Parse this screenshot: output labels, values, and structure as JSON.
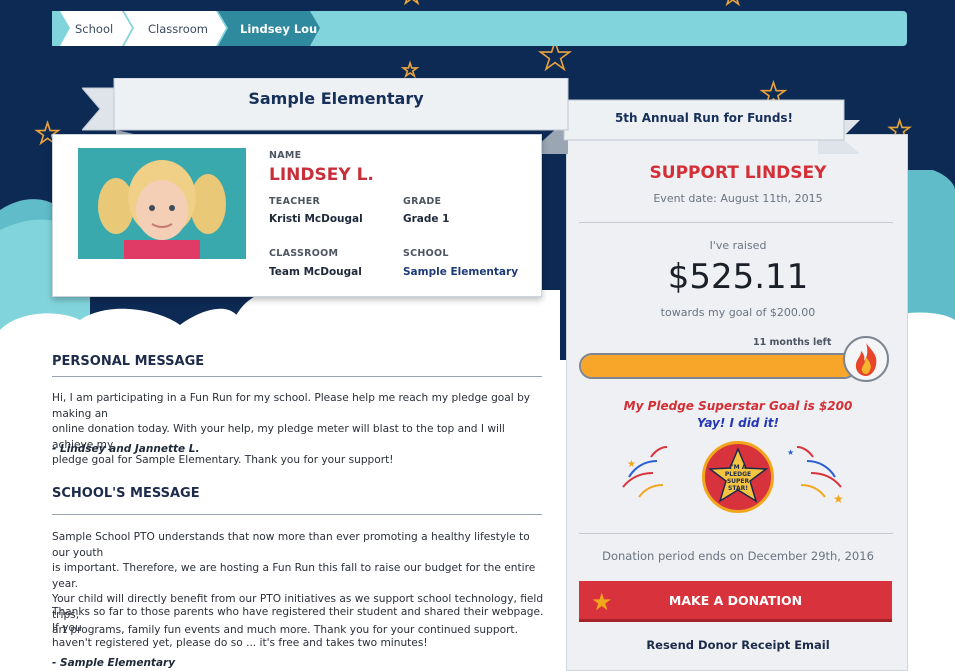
{
  "breadcrumb": {
    "items": [
      {
        "label": "School"
      },
      {
        "label": "Classroom"
      },
      {
        "label": "Lindsey Lou"
      }
    ]
  },
  "banner": {
    "school_name": "Sample Elementary",
    "event_name": "5th Annual Run for Funds!"
  },
  "profile": {
    "name_label": "NAME",
    "name": "LINDSEY L.",
    "teacher_label": "TEACHER",
    "teacher": "Kristi McDougal",
    "grade_label": "GRADE",
    "grade": "Grade 1",
    "classroom_label": "CLASSROOM",
    "classroom": "Team McDougal",
    "school_label": "SCHOOL",
    "school": "Sample Elementary"
  },
  "personal_message": {
    "title": "PERSONAL MESSAGE",
    "lines": [
      "Hi, I am participating in a Fun Run for my school. Please help me reach my pledge goal by making an",
      "online donation today. With your help, my pledge meter will blast to the top and I will achieve my",
      "pledge goal for Sample Elementary. Thank you for your support!"
    ],
    "signature": "- Lindsey and Jannette L."
  },
  "school_message": {
    "title": "SCHOOL'S MESSAGE",
    "para1_lines": [
      "Sample School PTO understands that now more than ever promoting a healthy lifestyle to our youth",
      "is important. Therefore, we are hosting a Fun Run this fall to raise our budget for the entire year.",
      "Your child will directly benefit from our PTO initiatives as we support school technology, field trips,",
      "art programs, family fun events and much more. Thank you for your continued support."
    ],
    "para2_lines": [
      "Thanks so far to those parents who have registered their student and shared their webpage. If you",
      "haven't registered yet, please do so ... it's free and takes two minutes!"
    ],
    "signature": "- Sample Elementary"
  },
  "support": {
    "title": "SUPPORT LINDSEY",
    "event_date": "Event date: August 11th, 2015",
    "raised_label": "I've raised",
    "raised_amount": "$525.11",
    "goal_text": "towards my goal of $200.00",
    "time_left": "11 months left",
    "progress_fraction": 1.0,
    "superstar_goal": "My Pledge Superstar Goal is $200",
    "achieved_text": "Yay! I did it!",
    "badge_lines": [
      "I'M A",
      "PLEDGE",
      "SUPER",
      "STAR!"
    ],
    "donation_period": "Donation period ends on December 29th, 2016",
    "donate_button": "MAKE A DONATION",
    "resend_link": "Resend Donor Receipt Email"
  },
  "colors": {
    "night_sky": "#0d2a55",
    "cloud": "#82d4dc",
    "accent_red": "#d8333c",
    "progress": "#f7a62a",
    "star_outline": "#e8a23a"
  },
  "icons": [
    "star-icon",
    "flame-icon",
    "fireworks-icon",
    "superstar-badge-icon"
  ]
}
